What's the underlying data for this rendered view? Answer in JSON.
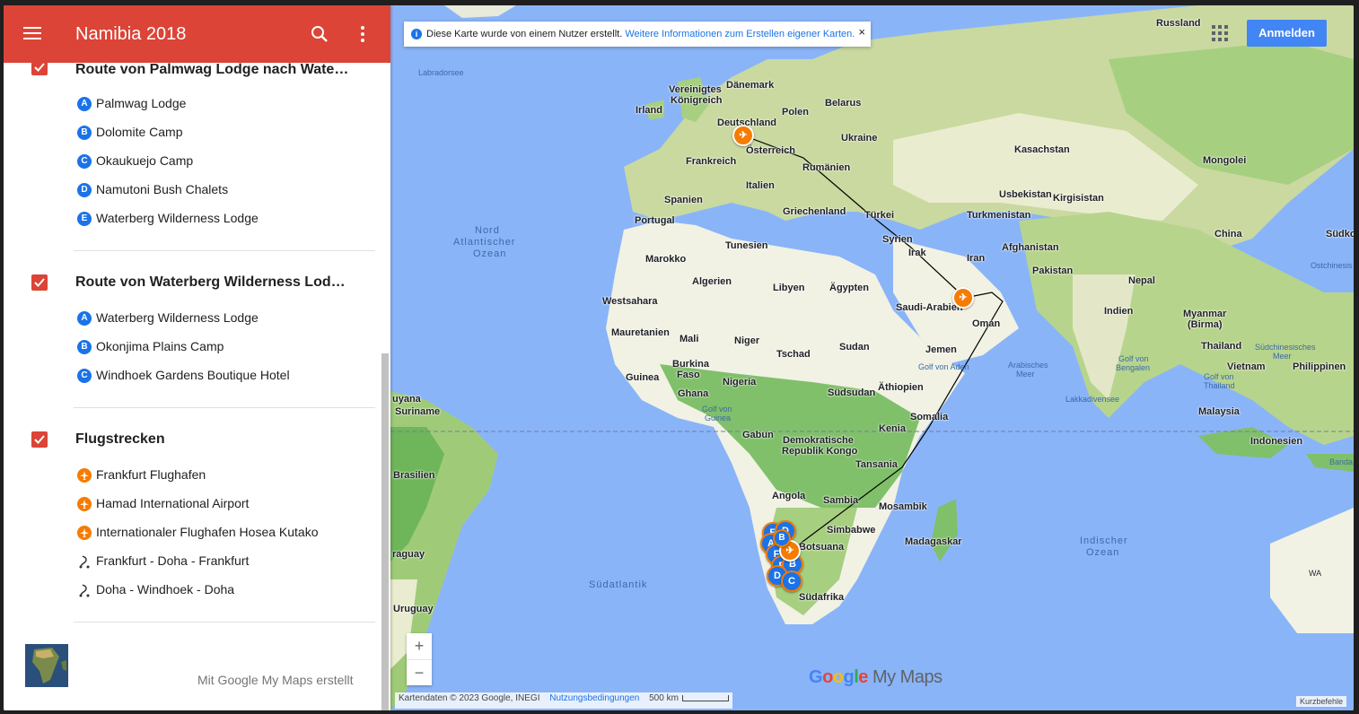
{
  "app": {
    "title": "Namibia 2018"
  },
  "layers": [
    {
      "title": "Route von Palmwag Lodge nach Waterbe…",
      "items": [
        {
          "badge": "A",
          "label": "Palmwag Lodge"
        },
        {
          "badge": "B",
          "label": "Dolomite Camp"
        },
        {
          "badge": "C",
          "label": "Okaukuejo Camp"
        },
        {
          "badge": "D",
          "label": "Namutoni Bush Chalets"
        },
        {
          "badge": "E",
          "label": "Waterberg Wilderness Lodge"
        }
      ]
    },
    {
      "title": "Route von Waterberg Wilderness Lodge …",
      "items": [
        {
          "badge": "A",
          "label": "Waterberg Wilderness Lodge"
        },
        {
          "badge": "B",
          "label": "Okonjima Plains Camp"
        },
        {
          "badge": "C",
          "label": "Windhoek Gardens Boutique Hotel"
        }
      ]
    },
    {
      "title": "Flugstrecken",
      "items": [
        {
          "icon": "airport-icon",
          "label": "Frankfurt Flughafen"
        },
        {
          "icon": "airport-icon",
          "label": "Hamad International Airport"
        },
        {
          "icon": "airport-icon",
          "label": "Internationaler Flughafen Hosea Kutako"
        },
        {
          "icon": "line-route-icon",
          "label": "Frankfurt - Doha - Frankfurt"
        },
        {
          "icon": "line-route-icon",
          "label": "Doha - Windhoek - Doha"
        }
      ]
    }
  ],
  "sidebar_footer": {
    "made_with": "Mit Google My Maps erstellt"
  },
  "map": {
    "notice_text": "Diese Karte wurde von einem Nutzer erstellt.",
    "notice_link": "Weitere Informationen zum Erstellen eigener Karten.",
    "notice_close": "×",
    "signin": "Anmelden",
    "zoom_in": "+",
    "zoom_out": "−",
    "attribution": "Kartendaten © 2023 Google, INEGI",
    "terms": "Nutzungsbedingungen",
    "scale": "500 km",
    "shortcuts": "Kurzbefehle",
    "logo_suffix": "My Maps",
    "labels": {
      "russland": "Russland",
      "labradorsee": "Labradorsee",
      "daenemark": "Dänemark",
      "uk1": "Vereinigtes",
      "uk2": "Königreich",
      "irland": "Irland",
      "deutschland": "Deutschland",
      "polen": "Polen",
      "belarus": "Belarus",
      "ukraine": "Ukraine",
      "oesterreich": "Österreich",
      "frankreich": "Frankreich",
      "rumaenien": "Rumänien",
      "kasachstan": "Kasachstan",
      "mongolei": "Mongolei",
      "spanien": "Spanien",
      "italien": "Italien",
      "portugal": "Portugal",
      "griechenland": "Griechenland",
      "tuerkei": "Türkei",
      "usbekistan": "Usbekistan",
      "kirgisistan": "Kirgisistan",
      "turkmenistan": "Turkmenistan",
      "china": "China",
      "suedko": "Südko",
      "atl1": "Nord",
      "atl2": "Atlantischer",
      "atl3": "Ozean",
      "tunesien": "Tunesien",
      "syrien": "Syrien",
      "afghanistan": "Afghanistan",
      "marokko": "Marokko",
      "irak": "Irak",
      "iran": "Iran",
      "ostchin": "Ostchinesis",
      "algerien": "Algerien",
      "libyen": "Libyen",
      "aegypten": "Ägypten",
      "pakistan": "Pakistan",
      "nepal": "Nepal",
      "westsahara": "Westsahara",
      "saudi": "Saudi-Arabien",
      "indien": "Indien",
      "myanmar1": "Myanmar",
      "myanmar2": "(Birma)",
      "oman": "Oman",
      "mauretanien": "Mauretanien",
      "mali": "Mali",
      "niger": "Niger",
      "sudan": "Sudan",
      "jemen": "Jemen",
      "thailand": "Thailand",
      "suedchin1": "Südchinesisches",
      "suedchin2": "Meer",
      "tschad": "Tschad",
      "burkina1": "Burkina",
      "burkina2": "Faso",
      "golfaden": "Golf von Aden",
      "arab1": "Arabisches",
      "arab2": "Meer",
      "golfbengalen1": "Golf von",
      "golfbengalen2": "Bengalen",
      "vietnam": "Vietnam",
      "philippinen": "Philippinen",
      "guinea": "Guinea",
      "nigeria": "Nigeria",
      "ghana": "Ghana",
      "suedsudan": "Südsudan",
      "aethiopien": "Äthiopien",
      "lakkadiven": "Lakkadivensee",
      "golfthai1": "Golf von",
      "golfthai2": "Thailand",
      "guyana": "uyana",
      "suriname": "Suriname",
      "golfguinea1": "Golf von",
      "golfguinea2": "Guinea",
      "somalia": "Somalia",
      "malaysia": "Malaysia",
      "gabun": "Gabun",
      "drk1": "Demokratische",
      "drk2": "Republik Kongo",
      "kenia": "Kenia",
      "indonesien": "Indonesien",
      "brasilien": "Brasilien",
      "tansania": "Tansania",
      "banda": "Banda",
      "angola": "Angola",
      "sambia": "Sambia",
      "mosambik": "Mosambik",
      "simbabwe": "Simbabwe",
      "botsuana": "Botsuana",
      "madagaskar": "Madagaskar",
      "ind1": "Indischer",
      "ind2": "Ozean",
      "paraguay": "raguay",
      "suedatlantik": "Südatlantik",
      "suedafrika": "Südafrika",
      "uruguay": "Uruguay",
      "wa": "WA"
    },
    "pins": {
      "fra": "✈",
      "doha": "✈",
      "wdh": "✈",
      "p1": "E",
      "p2": "D",
      "p3": "A",
      "p4": "B",
      "p5": "F",
      "p6": "E",
      "p7": "B",
      "p8": "D",
      "p9": "C"
    }
  }
}
